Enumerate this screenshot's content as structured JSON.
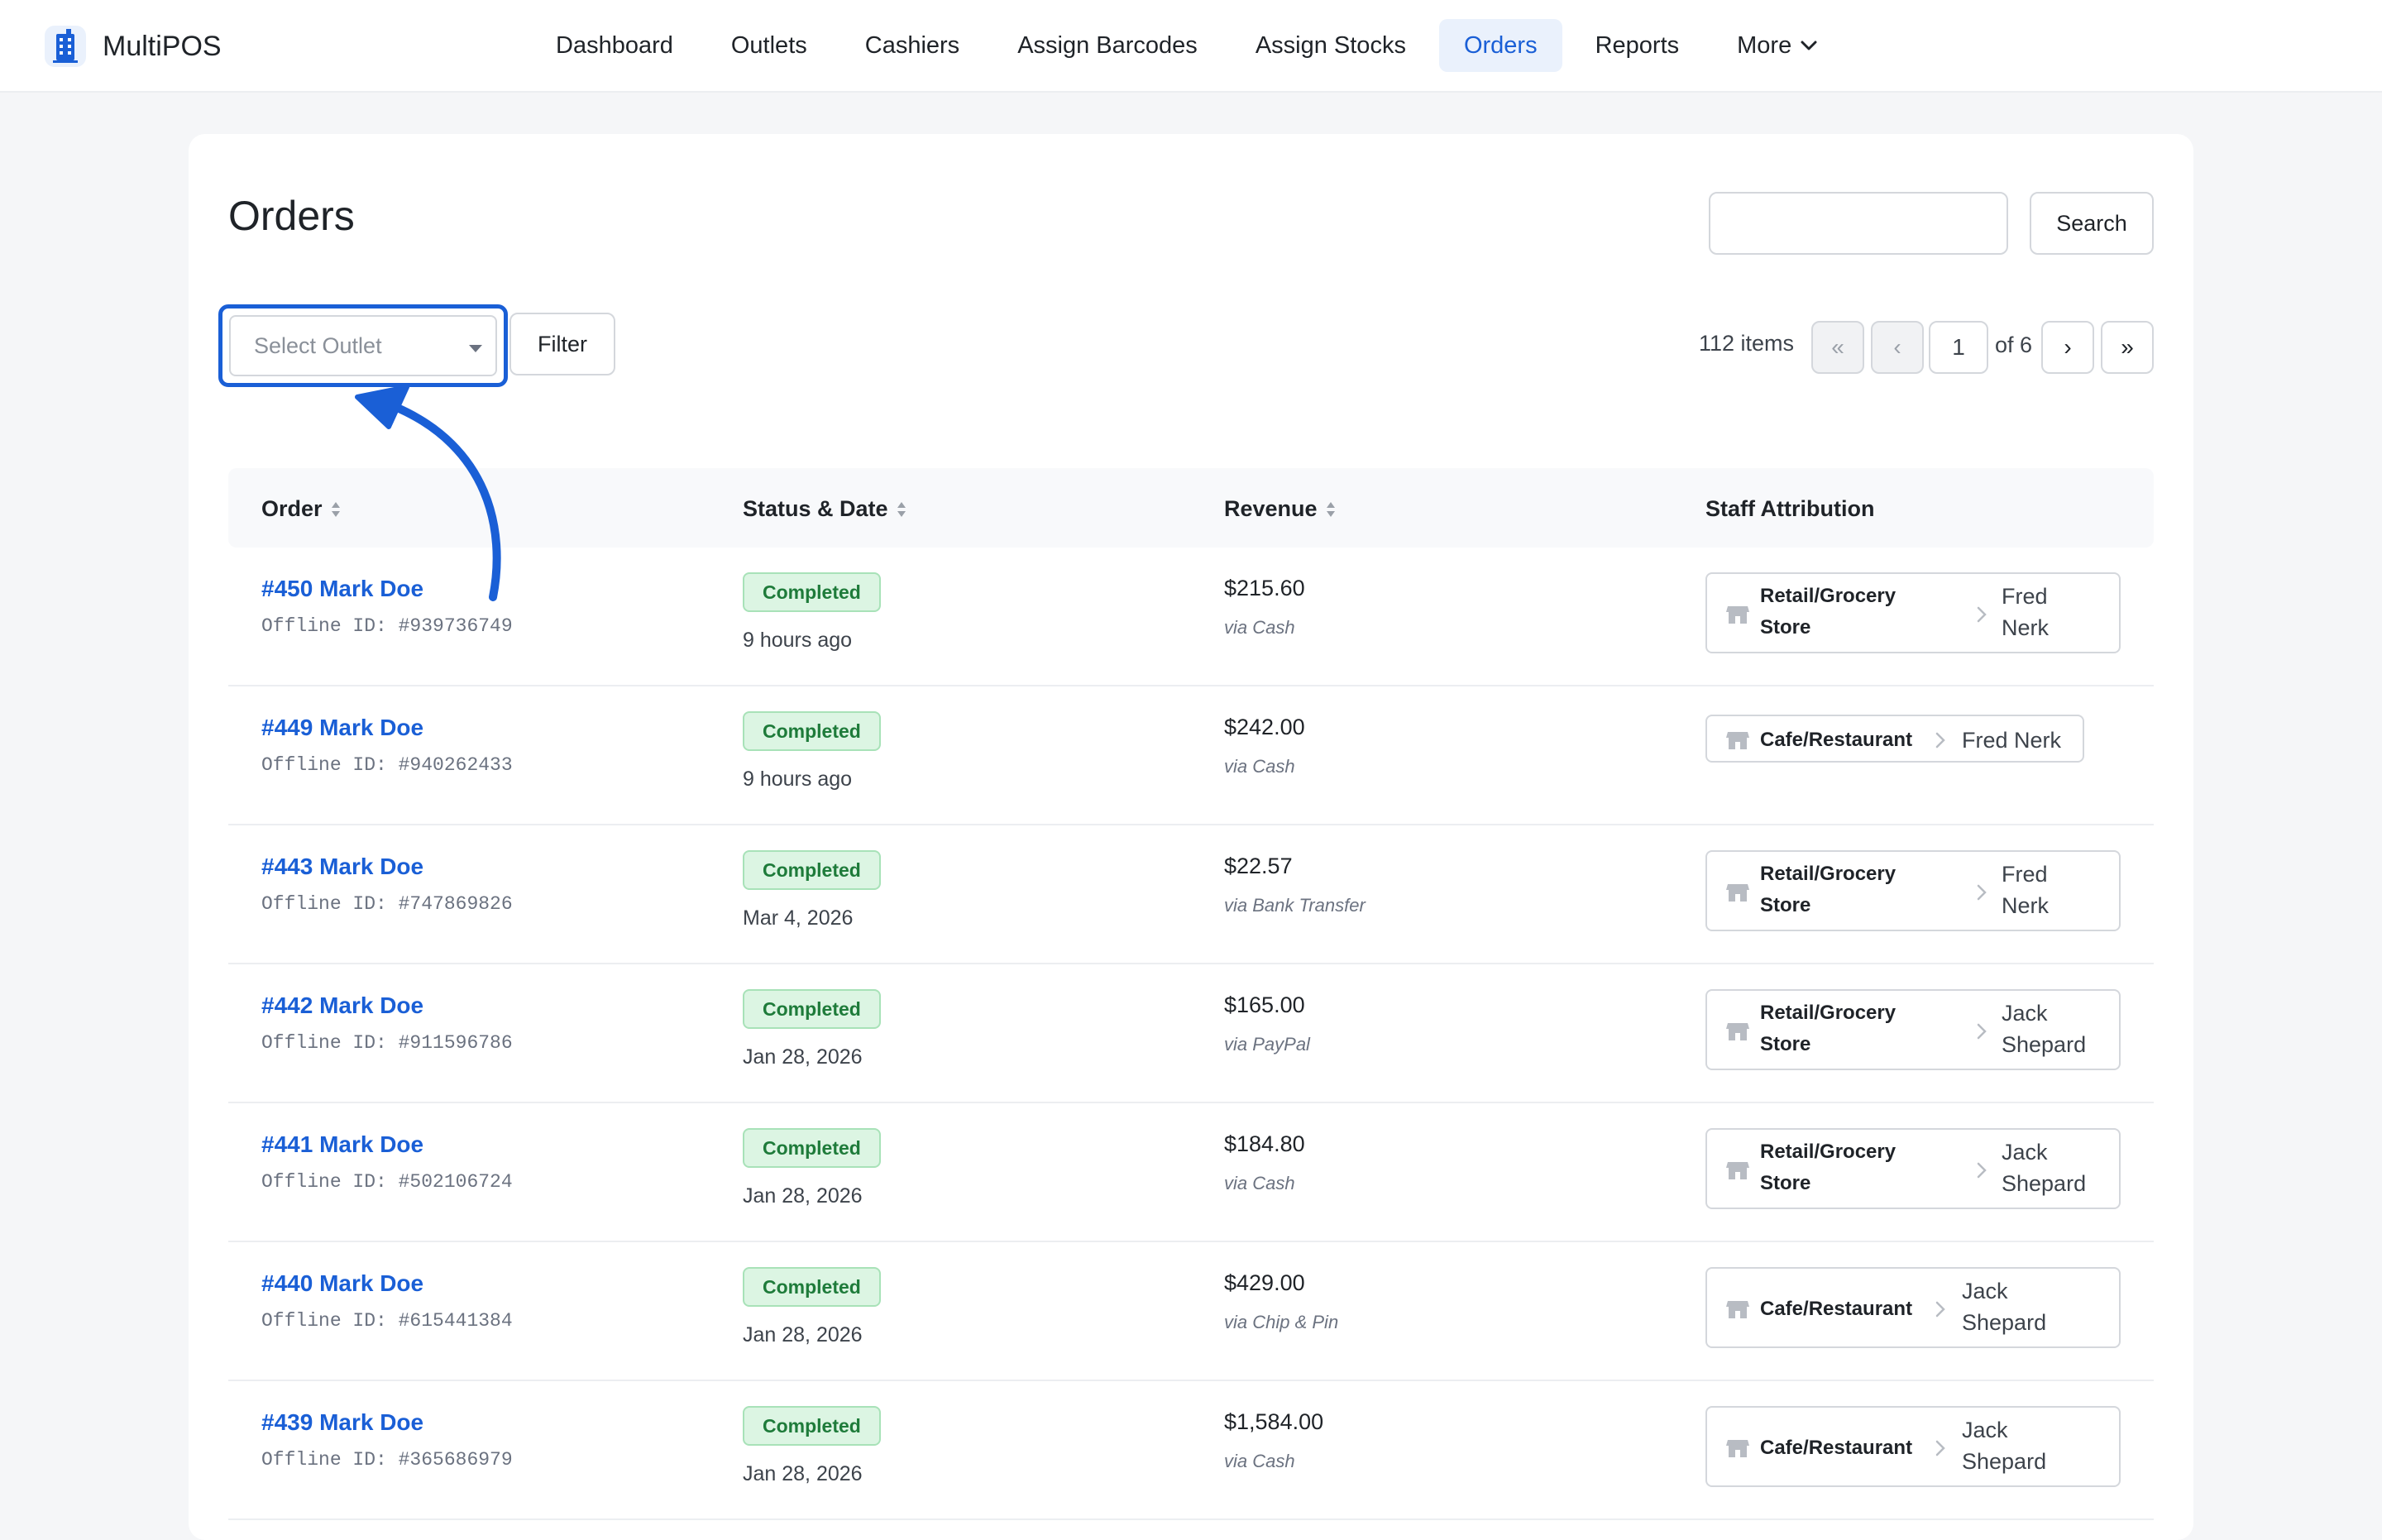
{
  "app": {
    "brand_name": "MultiPOS",
    "brand_color": "#1a5fd6"
  },
  "nav": {
    "items": [
      {
        "label": "Dashboard"
      },
      {
        "label": "Outlets"
      },
      {
        "label": "Cashiers"
      },
      {
        "label": "Assign Barcodes"
      },
      {
        "label": "Assign Stocks"
      },
      {
        "label": "Orders",
        "active": true
      },
      {
        "label": "Reports"
      },
      {
        "label": "More",
        "icon": "chevron-down-icon"
      }
    ]
  },
  "page": {
    "title": "Orders",
    "search": {
      "value": "",
      "button_label": "Search"
    },
    "filter": {
      "outlet_placeholder": "Select Outlet",
      "filter_label": "Filter",
      "highlight_color": "#1a5fd6"
    },
    "pagination": {
      "items_count": "112 items",
      "first": "«",
      "prev": "‹",
      "current_page": "1",
      "of_label": "of 6",
      "next": "›",
      "last": "»"
    }
  },
  "table": {
    "headers": {
      "order": "Order",
      "status_date": "Status & Date",
      "revenue": "Revenue",
      "staff": "Staff Attribution"
    },
    "rows": [
      {
        "order": "#450 Mark Doe",
        "offline_id": "Offline ID: #939736749",
        "status": "Completed",
        "date": "9 hours ago",
        "revenue": "$215.60",
        "method": "via Cash",
        "outlet": "Retail/Grocery Store",
        "staff": "Fred Nerk"
      },
      {
        "order": "#449 Mark Doe",
        "offline_id": "Offline ID: #940262433",
        "status": "Completed",
        "date": "9 hours ago",
        "revenue": "$242.00",
        "method": "via Cash",
        "outlet": "Cafe/Restaurant",
        "staff": "Fred Nerk"
      },
      {
        "order": "#443 Mark Doe",
        "offline_id": "Offline ID: #747869826",
        "status": "Completed",
        "date": "Mar 4, 2026",
        "revenue": "$22.57",
        "method": "via Bank Transfer",
        "outlet": "Retail/Grocery Store",
        "staff": "Fred Nerk"
      },
      {
        "order": "#442 Mark Doe",
        "offline_id": "Offline ID: #911596786",
        "status": "Completed",
        "date": "Jan 28, 2026",
        "revenue": "$165.00",
        "method": "via PayPal",
        "outlet": "Retail/Grocery Store",
        "staff": "Jack Shepard"
      },
      {
        "order": "#441 Mark Doe",
        "offline_id": "Offline ID: #502106724",
        "status": "Completed",
        "date": "Jan 28, 2026",
        "revenue": "$184.80",
        "method": "via Cash",
        "outlet": "Retail/Grocery Store",
        "staff": "Jack Shepard"
      },
      {
        "order": "#440 Mark Doe",
        "offline_id": "Offline ID: #615441384",
        "status": "Completed",
        "date": "Jan 28, 2026",
        "revenue": "$429.00",
        "method": "via Chip & Pin",
        "outlet": "Cafe/Restaurant",
        "staff": "Jack Shepard"
      },
      {
        "order": "#439 Mark Doe",
        "offline_id": "Offline ID: #365686979",
        "status": "Completed",
        "date": "Jan 28, 2026",
        "revenue": "$1,584.00",
        "method": "via Cash",
        "outlet": "Cafe/Restaurant",
        "staff": "Jack Shepard"
      }
    ]
  },
  "colors": {
    "link": "#1a5fd6",
    "status_completed_bg": "#dcf5e3",
    "status_completed_text": "#1e7b3a",
    "annotation_arrow": "#1a5fd6"
  }
}
